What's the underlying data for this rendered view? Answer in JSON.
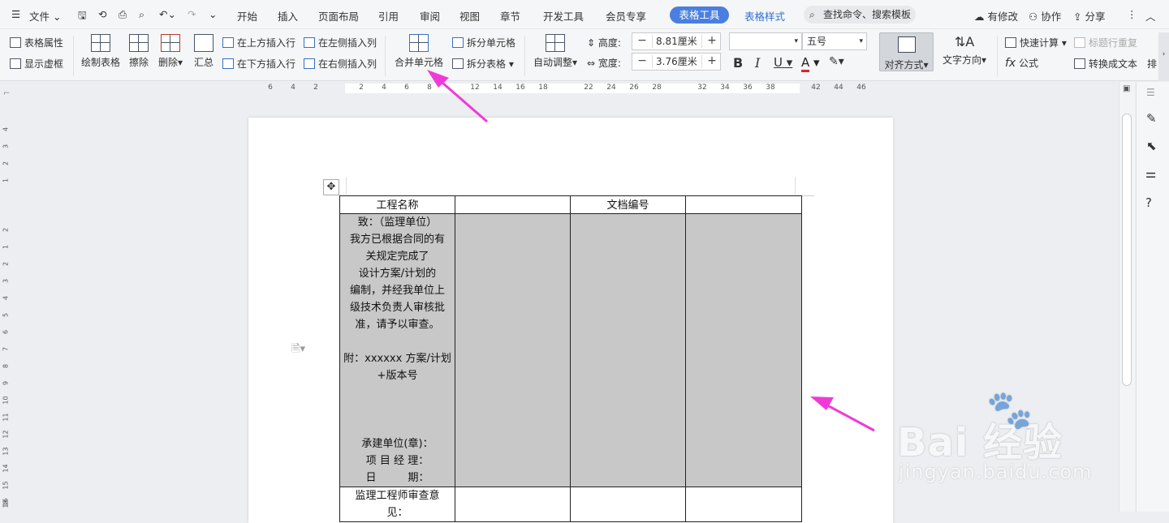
{
  "menubar": {
    "file": "文件",
    "tabs": [
      "开始",
      "插入",
      "页面布局",
      "引用",
      "审阅",
      "视图",
      "章节",
      "开发工具",
      "会员专享"
    ],
    "active_tab": "表格工具",
    "blue_tab": "表格样式",
    "search_placeholder": "查找命令、搜索模板",
    "right": {
      "modified": "有修改",
      "collab": "协作",
      "share": "分享"
    }
  },
  "ribbon": {
    "table_props": "表格属性",
    "show_gridlines": "显示虚框",
    "draw_table": "绘制表格",
    "erase": "擦除",
    "delete": "删除",
    "summary": "汇总",
    "insert_row_above": "在上方插入行",
    "insert_row_below": "在下方插入行",
    "insert_col_left": "在左侧插入列",
    "insert_col_right": "在右侧插入列",
    "merge_cells": "合并单元格",
    "split_cells": "拆分单元格",
    "split_table": "拆分表格",
    "auto_adjust": "自动调整",
    "height_label": "高度:",
    "height_value": "8.81厘米",
    "width_label": "宽度:",
    "width_value": "3.76厘米",
    "font_name": "",
    "font_size": "五号",
    "align": "对齐方式",
    "text_direction": "文字方向",
    "quick_calc": "快速计算",
    "formula": "公式",
    "header_repeat": "标题行重复",
    "convert_text": "转换成文本",
    "sort": "排"
  },
  "ruler": {
    "ticks": [
      "6",
      "4",
      "2",
      "2",
      "4",
      "6",
      "8",
      "12",
      "14",
      "16",
      "18",
      "22",
      "24",
      "26",
      "28",
      "32",
      "34",
      "36",
      "38",
      "42",
      "44",
      "46"
    ],
    "vticks": [
      "4",
      "3",
      "2",
      "1",
      "2",
      "1",
      "2",
      "3",
      "4",
      "5",
      "6",
      "7",
      "8",
      "9",
      "10",
      "11",
      "12",
      "13",
      "14",
      "15",
      "16",
      "18"
    ]
  },
  "table": {
    "project_name": "工程名称",
    "doc_number": "文档编号",
    "body_lines": [
      "致：（监理单位）",
      "我方已根据合同的有",
      "关规定完成了",
      "设计方案/计划的",
      "编制，并经我单位上",
      "级技术负责人审核批",
      "准，请予以审查。",
      "",
      "附：xxxxxx 方案/计划",
      "+版本号",
      "",
      "",
      "",
      "承建单位(章)：",
      "项 目 经 理：",
      "日　　　期："
    ],
    "supervisor_lines": [
      "监理工程师审查意",
      "见："
    ]
  },
  "watermark": {
    "big": "Bai 经验",
    "small": "jingyan.baidu.com"
  },
  "colors": {
    "accent": "#4a7fe0",
    "arrow": "#f03ad8",
    "selection": "#c8c8c8"
  }
}
